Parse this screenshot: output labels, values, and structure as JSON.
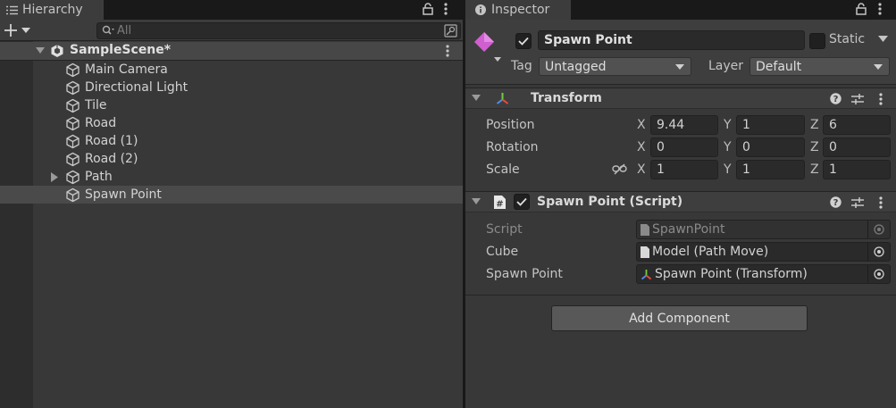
{
  "hierarchy": {
    "tab_title": "Hierarchy",
    "search_placeholder": "All",
    "scene_name": "SampleScene*",
    "items": [
      {
        "label": "Main Camera"
      },
      {
        "label": "Directional Light"
      },
      {
        "label": "Tile"
      },
      {
        "label": "Road"
      },
      {
        "label": "Road (1)"
      },
      {
        "label": "Road (2)"
      },
      {
        "label": "Path",
        "has_children": true
      },
      {
        "label": "Spawn Point",
        "selected": true
      }
    ]
  },
  "inspector": {
    "tab_title": "Inspector",
    "object_name": "Spawn Point",
    "active": true,
    "static_label": "Static",
    "tag_label": "Tag",
    "tag_value": "Untagged",
    "layer_label": "Layer",
    "layer_value": "Default",
    "transform": {
      "title": "Transform",
      "position_label": "Position",
      "rotation_label": "Rotation",
      "scale_label": "Scale",
      "x_label": "X",
      "y_label": "Y",
      "z_label": "Z",
      "position": {
        "x": "9.44",
        "y": "1",
        "z": "6"
      },
      "rotation": {
        "x": "0",
        "y": "0",
        "z": "0"
      },
      "scale": {
        "x": "1",
        "y": "1",
        "z": "1"
      }
    },
    "script_component": {
      "title": "Spawn Point (Script)",
      "enabled": true,
      "script_label": "Script",
      "script_value": "SpawnPoint",
      "cube_label": "Cube",
      "cube_value": "Model (Path Move)",
      "spawn_point_label": "Spawn Point",
      "spawn_point_value": "Spawn Point (Transform)"
    },
    "add_component_label": "Add Component"
  },
  "colors": {
    "panel_bg": "#383838",
    "tab_bar": "#191919",
    "selection": "#4a4a4a",
    "field_bg": "#2a2a2a",
    "gameobject_icon": "#d05fd0"
  }
}
